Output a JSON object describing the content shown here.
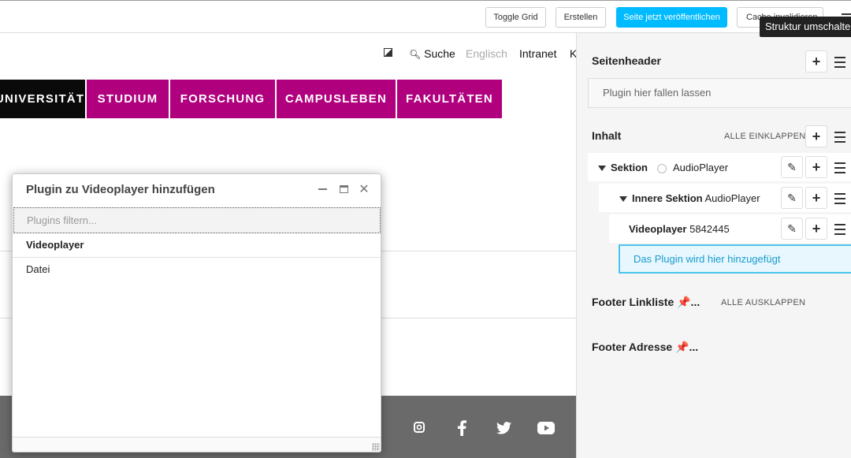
{
  "toolbar": {
    "toggle_grid": "Toggle Grid",
    "create": "Erstellen",
    "publish": "Seite jetzt veröffentlichen",
    "cache": "Cache invalidieren",
    "tooltip": "Struktur umschalten",
    "publish_color": "#00bbff"
  },
  "site": {
    "top_links": {
      "search": "Suche",
      "english": "Englisch",
      "intranet": "Intranet",
      "k": "K"
    },
    "nav": [
      "UNIVERSITÄT",
      "STUDIUM",
      "FORSCHUNG",
      "CAMPUSLEBEN",
      "FAKULTÄTEN"
    ],
    "nav_color": "#b0007e",
    "footer_social": [
      "instagram-icon",
      "facebook-icon",
      "twitter-icon",
      "youtube-icon"
    ]
  },
  "panel": {
    "header_title": "Seitenheader",
    "drop_placeholder": "Plugin hier fallen lassen",
    "content_title": "Inhalt",
    "collapse_all": "ALLE EINKLAPPEN",
    "tree": [
      {
        "type": "Sektion",
        "name": "AudioPlayer"
      },
      {
        "type": "Innere Sektion",
        "name": "AudioPlayer"
      },
      {
        "type": "Videoplayer",
        "name": "5842445"
      }
    ],
    "add_here": "Das Plugin wird hier hinzugefügt",
    "footer_links_title": "Footer Linkliste 📌...",
    "expand_all": "ALLE AUSKLAPPEN",
    "footer_address_title": "Footer Adresse 📌..."
  },
  "modal": {
    "title": "Plugin zu Videoplayer hinzufügen",
    "filter_placeholder": "Plugins filtern...",
    "group": "Videoplayer",
    "items": [
      "Datei"
    ]
  }
}
